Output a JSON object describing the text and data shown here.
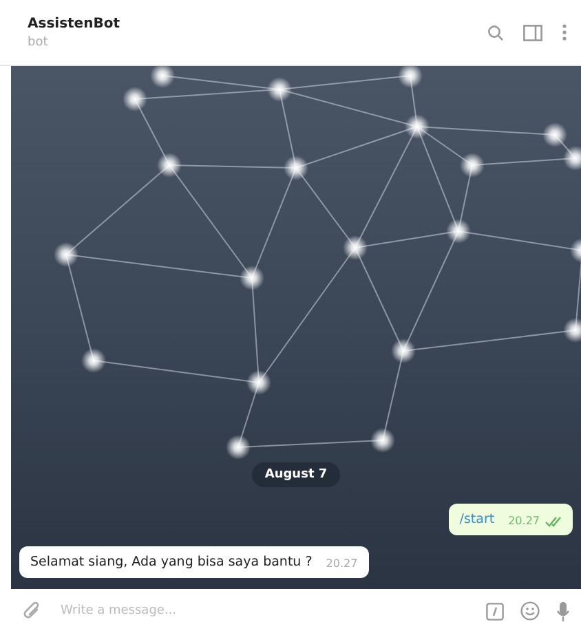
{
  "header": {
    "title": "AssistenBot",
    "subtitle": "bot"
  },
  "date_separator": "August 7",
  "messages": [
    {
      "kind": "outgoing",
      "text": "/start",
      "time": "20.27",
      "read": true
    },
    {
      "kind": "incoming",
      "text": "Selamat siang, Ada yang bisa saya bantu ?",
      "time": "20.27"
    }
  ],
  "composer": {
    "placeholder": "Write a message..."
  }
}
